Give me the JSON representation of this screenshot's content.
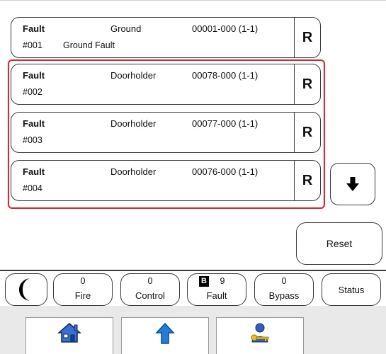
{
  "events": [
    {
      "type": "Fault",
      "device": "Ground",
      "address": "00001-000 (1-1)",
      "number": "#001",
      "description": "Ground Fault",
      "reset_label": "R"
    },
    {
      "type": "Fault",
      "device": "Doorholder",
      "address": "00078-000 (1-1)",
      "number": "#002",
      "description": "",
      "reset_label": "R"
    },
    {
      "type": "Fault",
      "device": "Doorholder",
      "address": "00077-000 (1-1)",
      "number": "#003",
      "description": "",
      "reset_label": "R"
    },
    {
      "type": "Fault",
      "device": "Doorholder",
      "address": "00076-000 (1-1)",
      "number": "#004",
      "description": "",
      "reset_label": "R"
    }
  ],
  "reset_button": {
    "label": "Reset"
  },
  "status_bar": {
    "fire": {
      "count": "0",
      "label": "Fire"
    },
    "control": {
      "count": "0",
      "label": "Control"
    },
    "fault": {
      "badge": "B",
      "count": "9",
      "label": "Fault"
    },
    "bypass": {
      "count": "0",
      "label": "Bypass"
    },
    "status": {
      "label": "Status"
    }
  },
  "nav": {
    "home_icon": "house-icon",
    "up_icon": "up-arrow-icon",
    "login_icon": "user-key-icon"
  },
  "colors": {
    "highlight": "#e8222c",
    "border": "#3a3a3a",
    "up_arrow": "#1f7fd8"
  }
}
